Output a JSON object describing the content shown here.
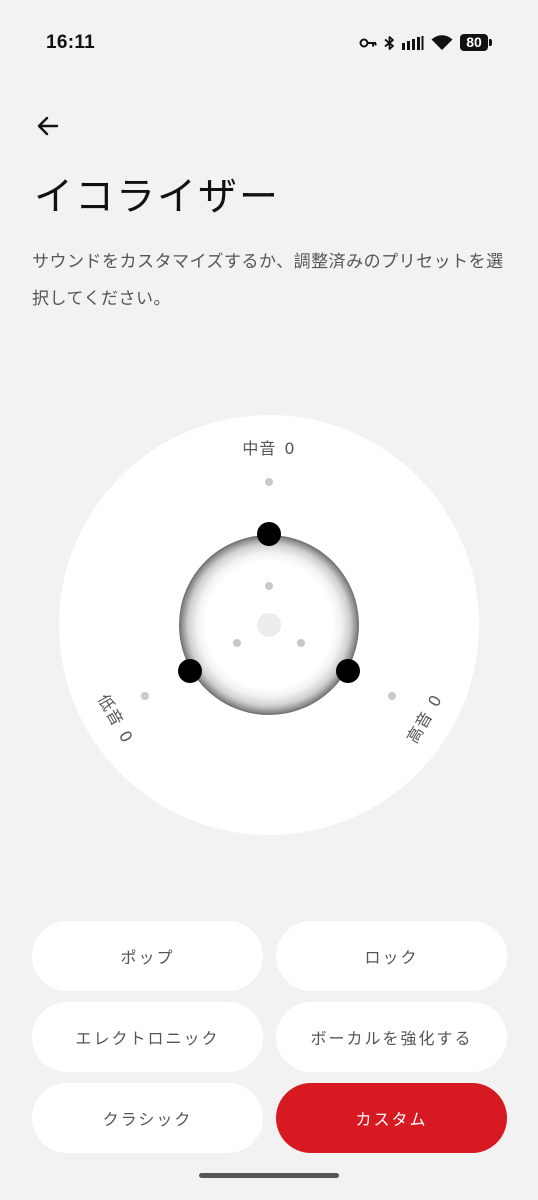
{
  "status_bar": {
    "time": "16:11",
    "battery": "80",
    "icons": [
      "key-icon",
      "bluetooth-icon",
      "signal-icon",
      "wifi-icon",
      "battery-icon"
    ]
  },
  "header": {
    "back_icon": "arrow-left-icon",
    "title": "イコライザー",
    "description": "サウンドをカスタマイズするか、調整済みのプリセットを選択してください。"
  },
  "equalizer": {
    "mid": {
      "label": "中音",
      "value": "0"
    },
    "bass": {
      "label": "低音",
      "value": "0"
    },
    "treble": {
      "label": "高音",
      "value": "0"
    }
  },
  "presets": [
    {
      "label": "ポップ",
      "active": false
    },
    {
      "label": "ロック",
      "active": false
    },
    {
      "label": "エレクトロニック",
      "active": false
    },
    {
      "label": "ボーカルを強化する",
      "active": false
    },
    {
      "label": "クラシック",
      "active": false
    },
    {
      "label": "カスタム",
      "active": true
    }
  ],
  "colors": {
    "background": "#f2f2f2",
    "accent": "#d71921",
    "surface": "#ffffff",
    "handle": "#000000"
  }
}
